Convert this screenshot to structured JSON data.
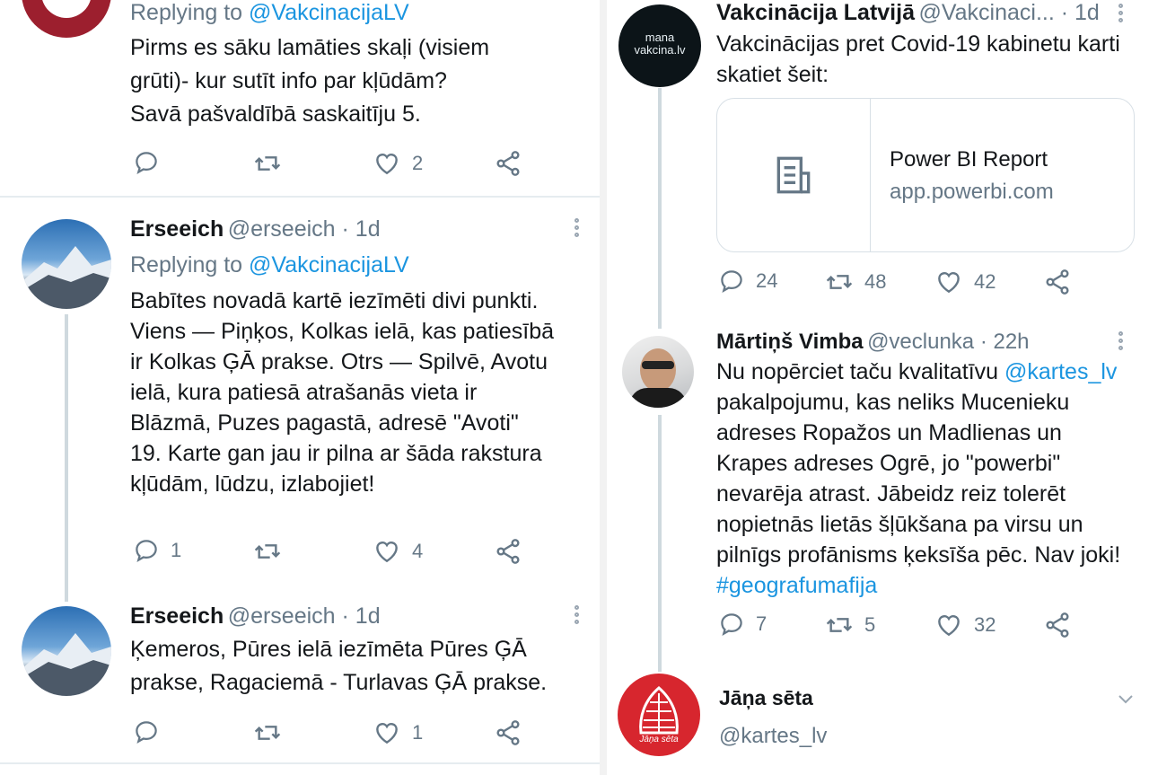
{
  "left": {
    "tweet1": {
      "replying_prefix": "Replying to ",
      "replying_to": "@VakcinacijaLV",
      "lines": [
        "Pirms es sāku lamāties skaļi (visiem",
        "grūti)- kur sutīt info par kļūdām?",
        "Savā pašvaldībā saskaitīju 5."
      ],
      "like_count": "2"
    },
    "tweet2": {
      "name": "Erseeich",
      "handle": "@erseeich · 1d",
      "replying_prefix": "Replying to ",
      "replying_to": "@VakcinacijaLV",
      "lines": [
        "Babītes novadā kartē iezīmēti divi punkti.",
        "Viens — Piņķos, Kolkas ielā, kas patiesībā",
        "ir Kolkas ĢĀ prakse. Otrs — Spilvē, Avotu",
        "ielā, kura patiesā atrašanās vieta ir",
        "Blāzmā, Puzes pagastā, adresē \"Avoti\"",
        "19. Karte gan jau ir pilna ar šāda rakstura",
        "kļūdām, lūdzu, izlabojiet!"
      ],
      "reply_count": "1",
      "like_count": "4"
    },
    "tweet3": {
      "name": "Erseeich",
      "handle": "@erseeich · 1d",
      "lines": [
        "Ķemeros, Pūres ielā iezīmēta Pūres ĢĀ",
        "prakse, Ragaciemā - Turlavas ĢĀ prakse."
      ],
      "like_count": "1"
    }
  },
  "right": {
    "tweet1": {
      "name": "Vakcinācija Latvijā",
      "handle": "@Vakcinaci... · 1d",
      "avatar_text": [
        "mana",
        "vakcina.lv"
      ],
      "lines": [
        "Vakcinācijas pret Covid-19 kabinetu karti",
        "skatiet šeit:"
      ],
      "card_title": "Power BI Report",
      "card_domain": "app.powerbi.com",
      "reply_count": "24",
      "retweet_count": "48",
      "like_count": "42"
    },
    "tweet2": {
      "name": "Mārtiņš Vimba",
      "handle": "@veclunka · 22h",
      "line1_prefix": "Nu nopērciet taču kvalitatīvu ",
      "line1_mention": "@kartes_lv",
      "lines": [
        "pakalpojumu, kas neliks Mucenieku",
        "adreses Ropažos un Madlienas un",
        "Krapes adreses Ogrē, jo \"powerbi\"",
        "nevarēja atrast. Jābeidz reiz tolerēt",
        "nopietnās lietās šļūkšana pa virsu un",
        "pilnīgs profānisms ķeksīša pēc. Nav joki!"
      ],
      "hashtag": "#geografumafija",
      "reply_count": "7",
      "retweet_count": "5",
      "like_count": "32"
    },
    "profile": {
      "name": "Jāņa sēta",
      "handle": "@kartes_lv",
      "avatar_text": "Jāņa sēta"
    }
  },
  "colors": {
    "link": "#1b95e0",
    "muted": "#657786",
    "text": "#14171a",
    "card_border": "#d8e0e6"
  }
}
